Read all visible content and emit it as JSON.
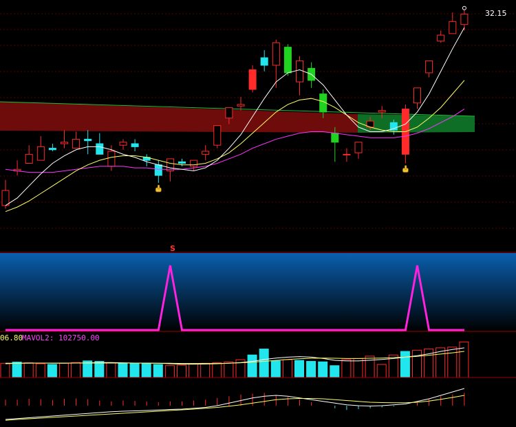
{
  "colors": {
    "up": "#ff2a2a",
    "down": "#22e6ee",
    "green_candle": "#21d321",
    "ma_white": "#ffffff",
    "ma_yellow": "#ffff66",
    "ma_magenta": "#ff33ff",
    "ribbon_red": "#7a0d0d",
    "ribbon_green": "#0f7a2a",
    "signal_line": "#ff22dd",
    "grid": "#5a0000",
    "panel_grad_top": "#0a5fae",
    "panel_grad_bottom": "#000000",
    "label_magenta": "#ff44ff",
    "label_yellow": "#ffff66"
  },
  "labels": {
    "price_high": "32.15",
    "signal_marker": "S",
    "vol_ma1_tail": "06.80",
    "vol_ma2": "MAVOL2: 102750.00"
  },
  "icons": {
    "pointer": "hand-pointer-icon"
  },
  "chart_data": [
    {
      "type": "candlestick",
      "panel": "price",
      "ylim": [
        17.5,
        33
      ],
      "grid": true,
      "candles": [
        {
          "o": 20.6,
          "h": 21.3,
          "l": 19.4,
          "c": 19.6,
          "col": "up"
        },
        {
          "o": 22.0,
          "h": 22.6,
          "l": 21.6,
          "c": 21.9,
          "col": "up"
        },
        {
          "o": 23.0,
          "h": 23.6,
          "l": 22.6,
          "c": 22.4,
          "col": "up"
        },
        {
          "o": 23.5,
          "h": 24.2,
          "l": 23.1,
          "c": 22.6,
          "col": "up"
        },
        {
          "o": 23.4,
          "h": 23.7,
          "l": 23.2,
          "c": 23.3,
          "col": "down"
        },
        {
          "o": 23.7,
          "h": 24.6,
          "l": 23.4,
          "c": 23.8,
          "col": "up"
        },
        {
          "o": 24.0,
          "h": 24.5,
          "l": 23.6,
          "c": 23.4,
          "col": "up"
        },
        {
          "o": 24.0,
          "h": 24.6,
          "l": 23.0,
          "c": 23.9,
          "col": "down"
        },
        {
          "o": 23.7,
          "h": 24.4,
          "l": 23.4,
          "c": 23.0,
          "col": "down"
        },
        {
          "o": 23.2,
          "h": 23.6,
          "l": 21.9,
          "c": 22.2,
          "col": "up"
        },
        {
          "o": 23.8,
          "h": 24.0,
          "l": 23.3,
          "c": 23.6,
          "col": "up"
        },
        {
          "o": 23.7,
          "h": 24.0,
          "l": 23.2,
          "c": 23.5,
          "col": "down"
        },
        {
          "o": 22.6,
          "h": 23.0,
          "l": 22.2,
          "c": 22.8,
          "col": "down"
        },
        {
          "o": 22.3,
          "h": 22.6,
          "l": 21.1,
          "c": 21.6,
          "col": "down"
        },
        {
          "o": 21.9,
          "h": 22.5,
          "l": 21.2,
          "c": 22.7,
          "col": "up"
        },
        {
          "o": 22.5,
          "h": 22.7,
          "l": 22.2,
          "c": 22.4,
          "col": "down"
        },
        {
          "o": 22.2,
          "h": 22.4,
          "l": 21.9,
          "c": 22.6,
          "col": "up"
        },
        {
          "o": 23.0,
          "h": 23.6,
          "l": 22.6,
          "c": 23.2,
          "col": "up"
        },
        {
          "o": 23.6,
          "h": 24.3,
          "l": 23.4,
          "c": 24.9,
          "col": "up"
        },
        {
          "o": 25.4,
          "h": 26.1,
          "l": 25.0,
          "c": 26.1,
          "col": "up"
        },
        {
          "o": 26.3,
          "h": 26.8,
          "l": 25.9,
          "c": 26.2,
          "col": "up"
        },
        {
          "o": 28.6,
          "h": 28.9,
          "l": 27.1,
          "c": 27.3,
          "col": "up"
        },
        {
          "o": 29.4,
          "h": 29.9,
          "l": 28.5,
          "c": 28.9,
          "col": "down"
        },
        {
          "o": 30.4,
          "h": 30.6,
          "l": 27.4,
          "c": 28.9,
          "col": "up"
        },
        {
          "o": 30.1,
          "h": 30.3,
          "l": 28.2,
          "c": 28.4,
          "col": "green"
        },
        {
          "o": 29.2,
          "h": 29.5,
          "l": 26.9,
          "c": 27.8,
          "col": "up"
        },
        {
          "o": 28.7,
          "h": 29.1,
          "l": 27.4,
          "c": 27.9,
          "col": "green"
        },
        {
          "o": 27.0,
          "h": 27.3,
          "l": 25.4,
          "c": 25.8,
          "col": "green"
        },
        {
          "o": 24.4,
          "h": 24.8,
          "l": 22.5,
          "c": 23.8,
          "col": "green"
        },
        {
          "o": 23.0,
          "h": 23.4,
          "l": 22.5,
          "c": 23.0,
          "col": "up"
        },
        {
          "o": 23.1,
          "h": 23.4,
          "l": 22.7,
          "c": 23.8,
          "col": "up"
        },
        {
          "o": 25.2,
          "h": 25.5,
          "l": 24.6,
          "c": 24.8,
          "col": "up"
        },
        {
          "o": 25.9,
          "h": 26.2,
          "l": 25.4,
          "c": 25.8,
          "col": "up"
        },
        {
          "o": 24.6,
          "h": 25.3,
          "l": 24.3,
          "c": 25.1,
          "col": "down"
        },
        {
          "o": 26.0,
          "h": 26.3,
          "l": 22.4,
          "c": 23.0,
          "col": "up"
        },
        {
          "o": 26.4,
          "h": 26.9,
          "l": 26.0,
          "c": 27.4,
          "col": "up"
        },
        {
          "o": 28.4,
          "h": 28.9,
          "l": 28.1,
          "c": 29.2,
          "col": "up"
        },
        {
          "o": 30.9,
          "h": 31.2,
          "l": 30.4,
          "c": 30.5,
          "col": "up"
        },
        {
          "o": 31.8,
          "h": 32.4,
          "l": 31.3,
          "c": 31.0,
          "col": "up"
        },
        {
          "o": 31.6,
          "h": 32.6,
          "l": 31.2,
          "c": 32.3,
          "col": "up"
        }
      ],
      "ma_white": [
        19.6,
        20.1,
        20.9,
        21.7,
        22.4,
        22.9,
        23.3,
        23.5,
        23.5,
        23.3,
        23.0,
        22.8,
        22.5,
        22.3,
        22.1,
        22.0,
        21.9,
        22.1,
        22.6,
        23.4,
        24.3,
        25.5,
        26.7,
        27.8,
        28.4,
        28.6,
        28.3,
        27.6,
        26.6,
        25.6,
        24.8,
        24.5,
        24.5,
        24.7,
        25.0,
        25.8,
        27.0,
        28.5,
        30.0,
        31.4
      ],
      "ma_yellow": [
        19.2,
        19.5,
        19.9,
        20.4,
        20.9,
        21.4,
        21.9,
        22.3,
        22.6,
        22.8,
        22.9,
        22.9,
        22.8,
        22.6,
        22.4,
        22.3,
        22.3,
        22.4,
        22.7,
        23.1,
        23.7,
        24.4,
        25.1,
        25.8,
        26.3,
        26.6,
        26.7,
        26.5,
        26.1,
        25.6,
        25.1,
        24.8,
        24.6,
        24.5,
        24.5,
        24.8,
        25.4,
        26.1,
        27.0,
        27.9
      ],
      "ma_magenta": [
        22.0,
        21.9,
        21.8,
        21.8,
        21.8,
        21.9,
        22.0,
        22.1,
        22.2,
        22.2,
        22.2,
        22.1,
        22.1,
        22.0,
        22.0,
        22.0,
        22.1,
        22.2,
        22.4,
        22.7,
        23.0,
        23.4,
        23.7,
        24.0,
        24.2,
        24.4,
        24.5,
        24.5,
        24.4,
        24.3,
        24.2,
        24.1,
        24.1,
        24.1,
        24.2,
        24.4,
        24.7,
        25.1,
        25.5,
        26.0
      ],
      "pointers_at": [
        13,
        34
      ]
    },
    {
      "type": "line",
      "panel": "signal",
      "ylim": [
        0,
        1
      ],
      "values": [
        0,
        0,
        0,
        0,
        0,
        0,
        0,
        0,
        0,
        0,
        0,
        0,
        0,
        0,
        1,
        0,
        0,
        0,
        0,
        0,
        0,
        0,
        0,
        0,
        0,
        0,
        0,
        0,
        0,
        0,
        0,
        0,
        0,
        0,
        0,
        1,
        0,
        0,
        0,
        0
      ],
      "marker_text_at": 14
    },
    {
      "type": "bar",
      "panel": "volume",
      "ylim": [
        0,
        200000
      ],
      "values": [
        60000,
        65000,
        62000,
        58000,
        55000,
        60000,
        63000,
        70000,
        68000,
        62000,
        61000,
        58000,
        60000,
        55000,
        50000,
        52000,
        58000,
        60000,
        62000,
        66000,
        75000,
        95000,
        120000,
        70000,
        75000,
        72000,
        68000,
        66000,
        50000,
        75000,
        80000,
        90000,
        55000,
        95000,
        110000,
        115000,
        120000,
        125000,
        128000,
        150000
      ],
      "colors": [
        "up",
        "down",
        "up",
        "up",
        "down",
        "up",
        "up",
        "down",
        "down",
        "up",
        "down",
        "down",
        "down",
        "down",
        "up",
        "up",
        "up",
        "up",
        "up",
        "up",
        "up",
        "down",
        "down",
        "down",
        "up",
        "down",
        "down",
        "down",
        "down",
        "up",
        "up",
        "up",
        "up",
        "up",
        "down",
        "up",
        "up",
        "up",
        "up",
        "up"
      ],
      "mavol1": [
        58000,
        60000,
        61000,
        61000,
        60000,
        60000,
        61000,
        62000,
        63000,
        63000,
        62000,
        61000,
        61000,
        60000,
        58000,
        56000,
        56000,
        57000,
        58000,
        60000,
        63000,
        68000,
        76000,
        82000,
        86000,
        88000,
        86000,
        80000,
        72000,
        70000,
        70000,
        73000,
        76000,
        80000,
        86000,
        92000,
        100000,
        110000,
        118000,
        125000
      ],
      "mavol2": [
        60000,
        60000,
        60000,
        61000,
        61000,
        61000,
        61000,
        61000,
        61000,
        61000,
        61000,
        61000,
        60000,
        60000,
        60000,
        59000,
        59000,
        59000,
        59000,
        60000,
        62000,
        65000,
        68000,
        72000,
        76000,
        79000,
        81000,
        82000,
        81000,
        80000,
        80000,
        81000,
        82000,
        84000,
        86000,
        89000,
        94000,
        99000,
        104000,
        110000
      ]
    },
    {
      "type": "bar",
      "panel": "macd",
      "ylim": [
        -1,
        1
      ],
      "values": [
        0.35,
        0.35,
        0.4,
        0.38,
        0.33,
        0.4,
        0.42,
        0.38,
        0.3,
        0.25,
        0.3,
        0.28,
        0.25,
        0.2,
        0.25,
        0.25,
        0.3,
        0.35,
        0.45,
        0.55,
        0.65,
        0.7,
        0.75,
        0.6,
        0.5,
        0.35,
        0.2,
        0.0,
        -0.15,
        -0.25,
        -0.2,
        -0.15,
        -0.1,
        -0.05,
        0.0,
        0.2,
        0.4,
        0.55,
        0.65,
        0.75
      ],
      "dif": [
        -0.8,
        -0.75,
        -0.7,
        -0.65,
        -0.6,
        -0.55,
        -0.5,
        -0.45,
        -0.4,
        -0.35,
        -0.32,
        -0.3,
        -0.28,
        -0.25,
        -0.22,
        -0.2,
        -0.15,
        -0.1,
        0.0,
        0.15,
        0.3,
        0.45,
        0.55,
        0.6,
        0.55,
        0.45,
        0.35,
        0.25,
        0.15,
        0.05,
        0.0,
        -0.02,
        0.0,
        0.05,
        0.1,
        0.25,
        0.4,
        0.6,
        0.8,
        1.0
      ],
      "dea": [
        -0.85,
        -0.8,
        -0.76,
        -0.72,
        -0.68,
        -0.64,
        -0.6,
        -0.56,
        -0.52,
        -0.48,
        -0.44,
        -0.4,
        -0.36,
        -0.32,
        -0.28,
        -0.24,
        -0.2,
        -0.15,
        -0.1,
        -0.03,
        0.05,
        0.15,
        0.25,
        0.35,
        0.4,
        0.42,
        0.42,
        0.4,
        0.35,
        0.3,
        0.25,
        0.2,
        0.18,
        0.17,
        0.17,
        0.2,
        0.27,
        0.37,
        0.48,
        0.6
      ]
    }
  ]
}
